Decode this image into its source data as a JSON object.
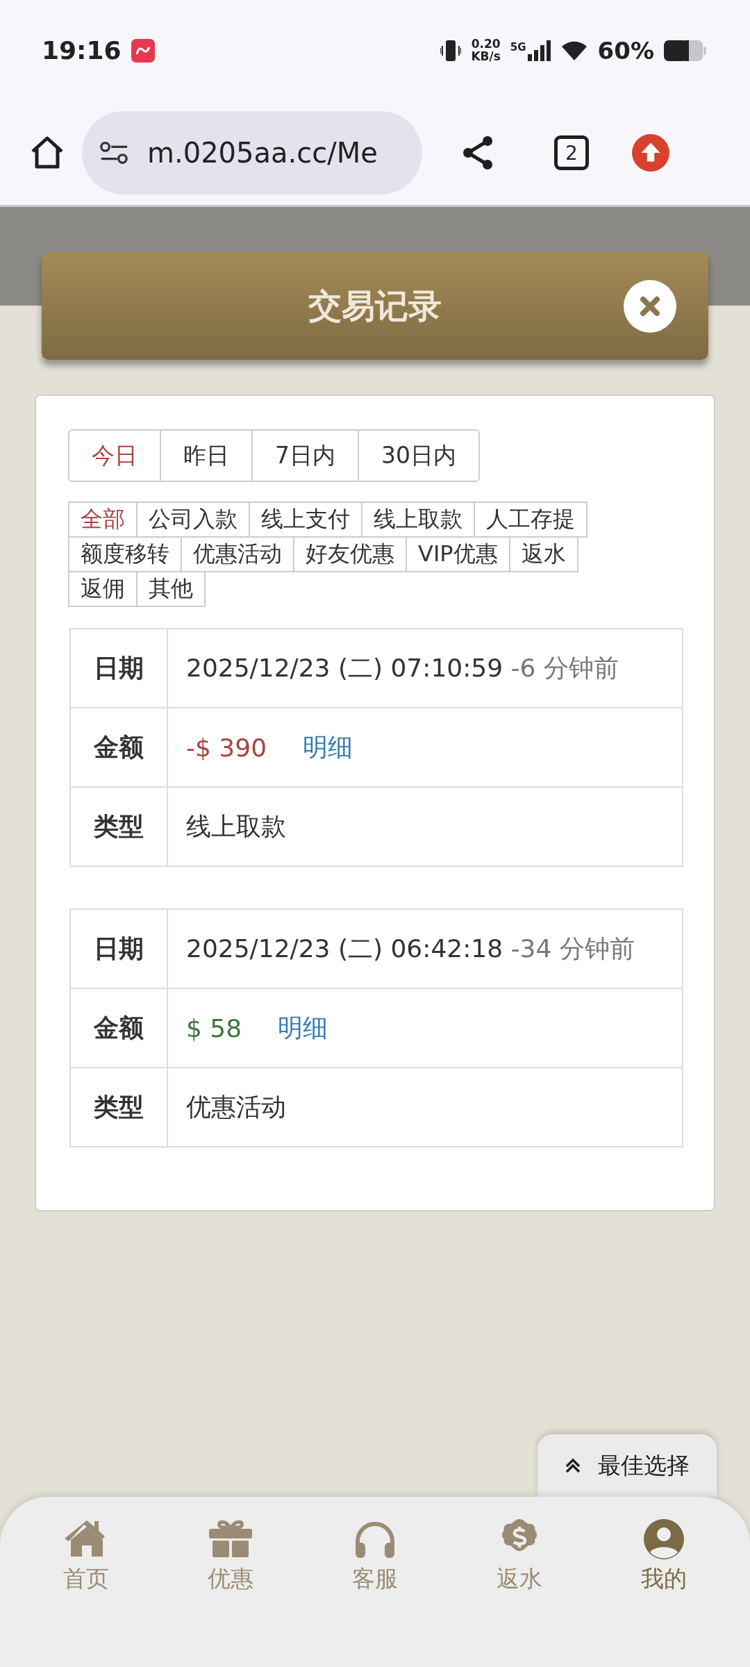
{
  "status_bar": {
    "time": "19:16",
    "net_speed_value": "0.20",
    "net_speed_unit": "KB/s",
    "network": "5G",
    "battery": "60%"
  },
  "browser": {
    "url": "m.0205aa.cc/Me",
    "tab_count": "2"
  },
  "dialog": {
    "title": "交易记录"
  },
  "date_tabs": [
    {
      "label": "今日",
      "selected": true
    },
    {
      "label": "昨日",
      "selected": false
    },
    {
      "label": "7日内",
      "selected": false
    },
    {
      "label": "30日内",
      "selected": false
    }
  ],
  "category_rows": [
    [
      {
        "label": "全部",
        "selected": true
      },
      {
        "label": "公司入款",
        "selected": false
      },
      {
        "label": "线上支付",
        "selected": false
      },
      {
        "label": "线上取款",
        "selected": false
      },
      {
        "label": "人工存提",
        "selected": false
      }
    ],
    [
      {
        "label": "额度移转",
        "selected": false
      },
      {
        "label": "优惠活动",
        "selected": false
      },
      {
        "label": "好友优惠",
        "selected": false
      },
      {
        "label": "VIP优惠",
        "selected": false
      },
      {
        "label": "返水",
        "selected": false
      }
    ],
    [
      {
        "label": "返佣",
        "selected": false
      },
      {
        "label": "其他",
        "selected": false
      }
    ]
  ],
  "records": [
    {
      "date_label": "日期",
      "datetime": "2025/12/23 (二) 07:10:59",
      "ago": "-6 分钟前",
      "amount_label": "金额",
      "amount": "-$ 390",
      "color": "#a94442",
      "detail_link": "明细",
      "type_label": "类型",
      "type": "线上取款"
    },
    {
      "date_label": "日期",
      "datetime": "2025/12/23 (二) 06:42:18",
      "ago": "-34 分钟前",
      "amount_label": "金额",
      "amount": "$ 58",
      "color": "#3c763d",
      "detail_link": "明细",
      "type_label": "类型",
      "type": "优惠活动"
    }
  ],
  "float_button": {
    "label": "最佳选择"
  },
  "bottom_nav": [
    {
      "label": "首页",
      "selected": false
    },
    {
      "label": "优惠",
      "selected": false
    },
    {
      "label": "客服",
      "selected": false
    },
    {
      "label": "返水",
      "selected": false
    },
    {
      "label": "我的",
      "selected": true
    }
  ]
}
